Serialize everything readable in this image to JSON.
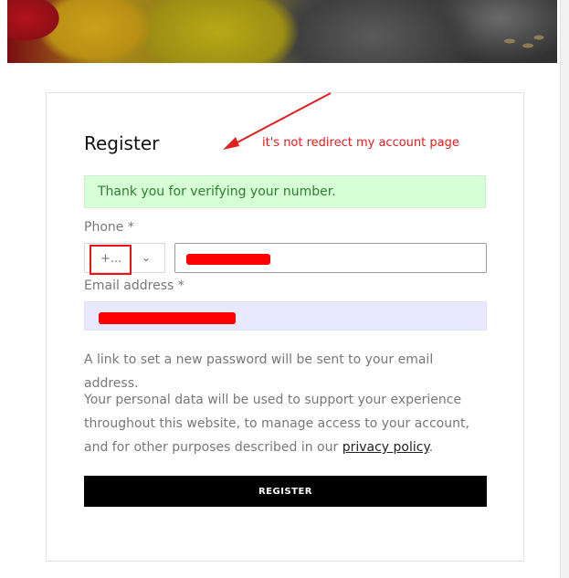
{
  "form": {
    "title": "Register",
    "notice": "Thank you for verifying your number.",
    "phone_label": "Phone *",
    "country_code": "+...",
    "email_label": "Email address *",
    "password_hint": "A link to set a new password will be sent to your email address.",
    "privacy_text_before": "Your personal data will be used to support your experience throughout this website, to manage access to your account, and for other purposes described in our ",
    "privacy_link": "privacy policy",
    "privacy_text_after": ".",
    "register_label": "REGISTER"
  },
  "annotation": {
    "text": "it's not redirect my account page",
    "color": "#e02020"
  },
  "icons": {
    "dropdown": "chevron-down-icon"
  },
  "colors": {
    "notice_bg": "#d6ffd6",
    "notice_text": "#2e7d32",
    "redaction": "#ff0000",
    "button_bg": "#000000"
  }
}
